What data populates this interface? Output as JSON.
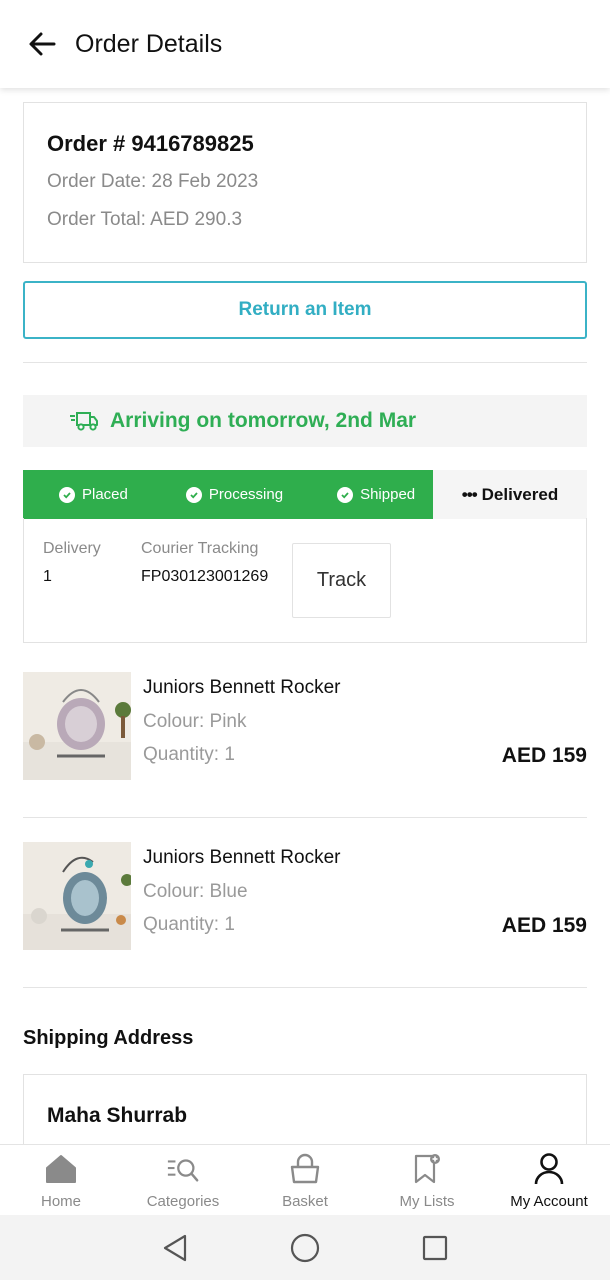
{
  "header": {
    "title": "Order Details"
  },
  "order": {
    "number": "Order # 9416789825",
    "date": "Order Date: 28 Feb 2023",
    "total": "Order Total: AED 290.3"
  },
  "return_button": "Return an Item",
  "arrival": {
    "text": "Arriving on tomorrow, 2nd Mar",
    "color": "#2fae55"
  },
  "progress": {
    "steps": [
      "Placed",
      "Processing",
      "Shipped"
    ],
    "pending_step": "Delivered",
    "pending_prefix": "•••",
    "color": "#2fae4c"
  },
  "tracking": {
    "delivery_label": "Delivery",
    "delivery_value": "1",
    "courier_label": "Courier Tracking",
    "courier_value": "FP030123001269",
    "track_button": "Track"
  },
  "products": [
    {
      "name": "Juniors Bennett Rocker",
      "colour": "Colour: Pink",
      "quantity": "Quantity: 1",
      "price": "AED 159"
    },
    {
      "name": "Juniors Bennett Rocker",
      "colour": "Colour: Blue",
      "quantity": "Quantity: 1",
      "price": "AED 159"
    }
  ],
  "shipping": {
    "title": "Shipping Address",
    "name": "Maha Shurrab"
  },
  "bottom_nav": {
    "items": [
      {
        "label": "Home",
        "icon": "home-icon"
      },
      {
        "label": "Categories",
        "icon": "categories-icon"
      },
      {
        "label": "Basket",
        "icon": "basket-icon"
      },
      {
        "label": "My Lists",
        "icon": "my-lists-icon"
      },
      {
        "label": "My Account",
        "icon": "account-icon",
        "active": true
      }
    ]
  },
  "accent_color": "#32aec3"
}
